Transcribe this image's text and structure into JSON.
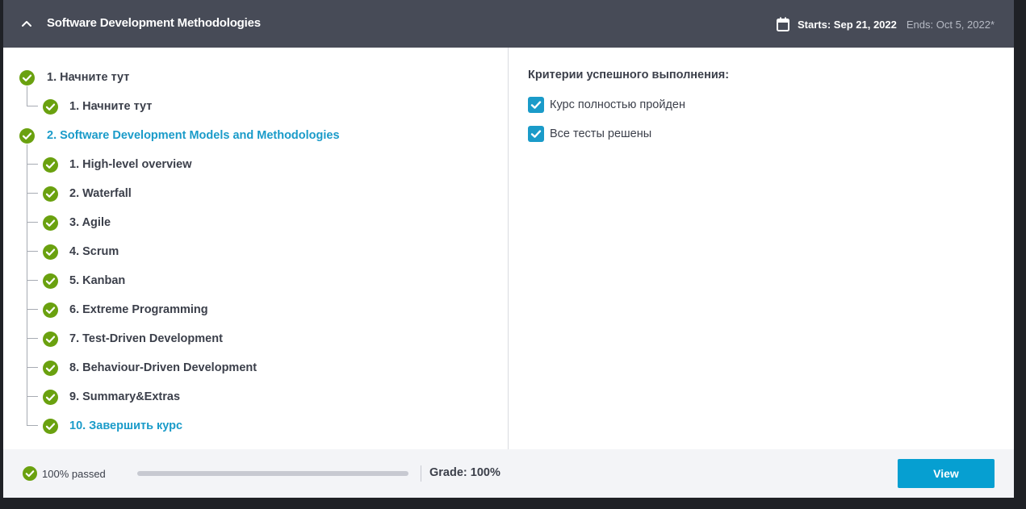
{
  "header": {
    "title": "Software Development Methodologies",
    "starts": "Starts: Sep 21, 2022",
    "ends": "Ends: Oct 5, 2022*"
  },
  "outline": {
    "section1": {
      "label": "1. Начните тут",
      "items": [
        "1. Начните тут"
      ]
    },
    "section2": {
      "label": "2. Software Development Models and Methodologies",
      "items": [
        "1. High-level overview",
        "2. Waterfall",
        "3. Agile",
        "4. Scrum",
        "5. Kanban",
        "6. Extreme Programming",
        "7. Test-Driven Development",
        "8. Behaviour-Driven Development",
        "9. Summary&Extras",
        "10. Завершить курс"
      ]
    }
  },
  "criteria": {
    "title": "Критерии успешного выполнения:",
    "items": [
      {
        "label": "Курс полностью пройден",
        "checked": true
      },
      {
        "label": "Все тесты решены",
        "checked": true
      }
    ]
  },
  "footer": {
    "passed": "100% passed",
    "progress": 1.0,
    "grade": "Grade: 100%",
    "view_label": "View"
  },
  "colors": {
    "header_bg": "#474b57",
    "check_green": "#6aa10f",
    "link_blue": "#1a9bc9",
    "button_blue": "#069fd1"
  }
}
